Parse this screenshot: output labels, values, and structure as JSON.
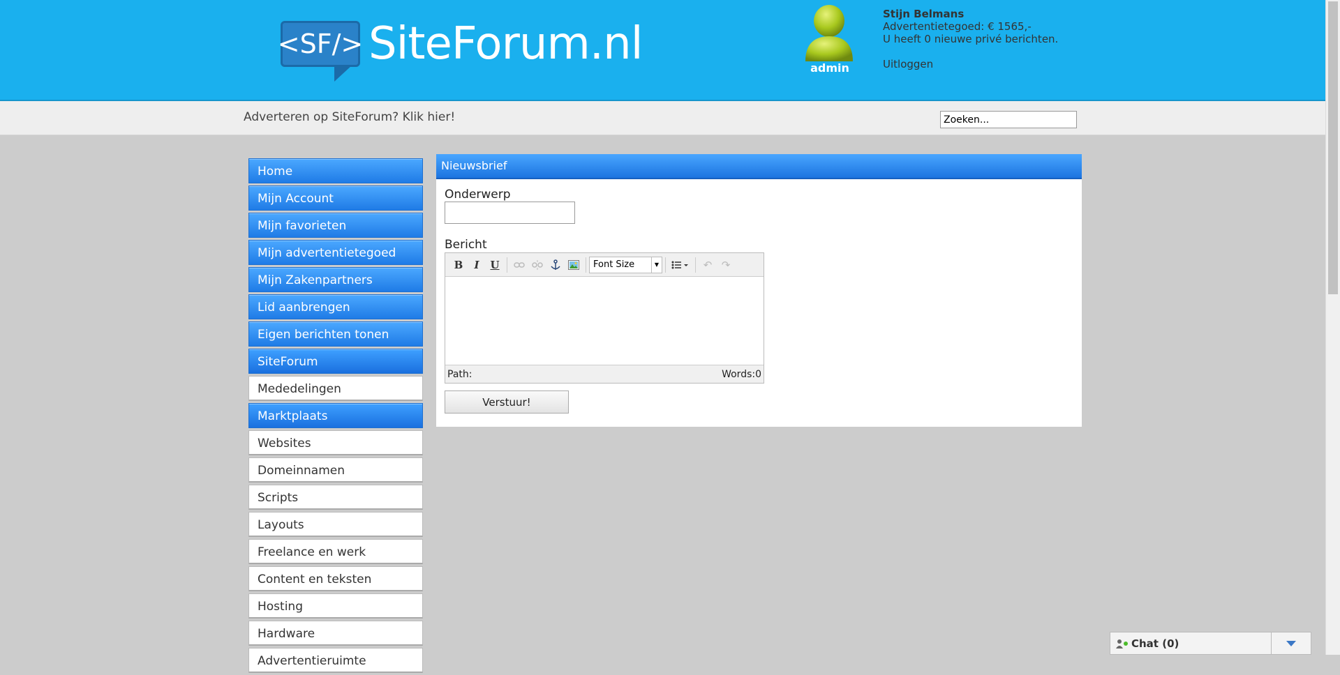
{
  "header": {
    "logo_badge": "<SF/>",
    "logo_text": "SiteForum.nl",
    "avatar_label": "admin",
    "user_name": "Stijn Belmans",
    "credit": "Advertentietegoed: € 1565,-",
    "messages": "U heeft 0 nieuwe privé berichten.",
    "logout": "Uitloggen"
  },
  "subbar": {
    "advert": "Adverteren op SiteForum? Klik hier!",
    "search_value": "Zoeken..."
  },
  "sidebar": {
    "items": [
      {
        "label": "Home"
      },
      {
        "label": "Mijn Account"
      },
      {
        "label": "Mijn favorieten"
      },
      {
        "label": "Mijn advertentietegoed"
      },
      {
        "label": "Mijn Zakenpartners"
      },
      {
        "label": "Lid aanbrengen"
      },
      {
        "label": "Eigen berichten tonen"
      },
      {
        "label": "SiteForum"
      },
      {
        "label": "Mededelingen"
      },
      {
        "label": "Marktplaats"
      },
      {
        "label": "Websites"
      },
      {
        "label": "Domeinnamen"
      },
      {
        "label": "Scripts"
      },
      {
        "label": "Layouts"
      },
      {
        "label": "Freelance en werk"
      },
      {
        "label": "Content en teksten"
      },
      {
        "label": "Hosting"
      },
      {
        "label": "Hardware"
      },
      {
        "label": "Advertentieruimte"
      }
    ]
  },
  "panel": {
    "title": "Nieuwsbrief",
    "subject_label": "Onderwerp",
    "subject_value": "",
    "message_label": "Bericht",
    "toolbar": {
      "bold": "B",
      "italic": "I",
      "underline": "U",
      "font_size": "Font Size"
    },
    "path_label": "Path:",
    "words_label": "Words:0",
    "submit_label": "Verstuur!"
  },
  "chat": {
    "label": "Chat",
    "open_paren": "(",
    "count": "0",
    "close_paren": ")"
  },
  "colors": {
    "header_bg": "#1ab0ee",
    "nav_blue": "#2a86ef",
    "page_bg": "#cccccc"
  }
}
